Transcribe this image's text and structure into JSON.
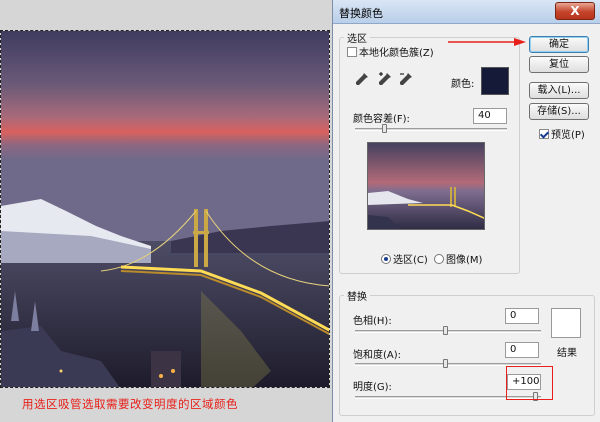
{
  "dialog": {
    "title": "替换颜色",
    "close_label": "X",
    "selection": {
      "group_label": "选区",
      "localized_clusters_label": "本地化颜色簇(Z)",
      "localized_clusters_checked": false,
      "color_label": "颜色:",
      "sample_color": "#141a38",
      "fuzziness_label": "颜色容差(F):",
      "fuzziness_value": "40",
      "fuzziness_level": 40,
      "fuzziness_max": 200,
      "mode_selection_label": "选区(C)",
      "mode_image_label": "图像(M)",
      "mode_selected": "selection"
    },
    "replacement": {
      "group_label": "替换",
      "hue_label": "色相(H):",
      "hue_value": "0",
      "saturation_label": "饱和度(A):",
      "saturation_value": "0",
      "lightness_label": "明度(G):",
      "lightness_value": "+100",
      "result_label": "结果",
      "result_color": "#ffffff"
    },
    "buttons": {
      "ok": "确定",
      "reset": "复位",
      "load": "载入(L)...",
      "save": "存储(S)...",
      "preview_label": "预览(P)",
      "preview_checked": true
    }
  },
  "canvas": {
    "caption": "用选区吸管选取需要改变明度的区域颜色"
  },
  "colors": {
    "annotation_red": "#e8201a",
    "sky_top": "#3d3a5e",
    "sky_glow": "#d25a5a",
    "water": "#2c2a40"
  }
}
